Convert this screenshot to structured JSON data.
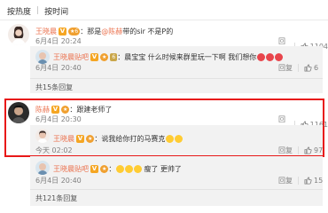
{
  "sort": {
    "hot": "按热度",
    "separator": "|",
    "time": "按时间"
  },
  "comments": [
    {
      "user": "王晓晨",
      "vip": "V",
      "level": "★6",
      "text_prefix": "：那是",
      "mention": "@陈赫",
      "text_suffix": " 带的sir 不是P的",
      "time": "6月4日 20:24",
      "reply_label": "回复",
      "likes": "1104",
      "replies": [
        {
          "user": "王晓晨贴吧",
          "vip": "V",
          "level": "★",
          "level2": "6",
          "text": "：晨宝宝 什么时候来群里玩一下啊 我们想你",
          "time": "6月4日 20:40",
          "reply_label": "回复",
          "likes": "6"
        }
      ],
      "more": "共15条回复"
    },
    {
      "user": "陈赫",
      "vip": "V",
      "level": "★",
      "text": "：跟建老师了",
      "time": "6月4日 20:30",
      "reply_label": "回复",
      "likes": "1161",
      "replies": [
        {
          "user": "王晓晨",
          "vip": "V",
          "level": "★",
          "text": "：说我给你打的马赛克",
          "time": "今天 02:02",
          "reply_label": "回复",
          "likes": "97"
        },
        {
          "user": "王晓晨贴吧",
          "vip": "V",
          "level": "★",
          "text": "瘦了 更帅了",
          "time": "6月4日 20:40",
          "reply_label": "回复",
          "likes": "15"
        }
      ],
      "more": "共121条回复"
    }
  ],
  "colors": {
    "username": "#eb7350",
    "highlight_border": "#e81818",
    "subcomment_bg": "#f2f2f2"
  },
  "icons": {
    "like": "thumbs-up-icon",
    "emoji": "smiley-emoji-icon"
  }
}
